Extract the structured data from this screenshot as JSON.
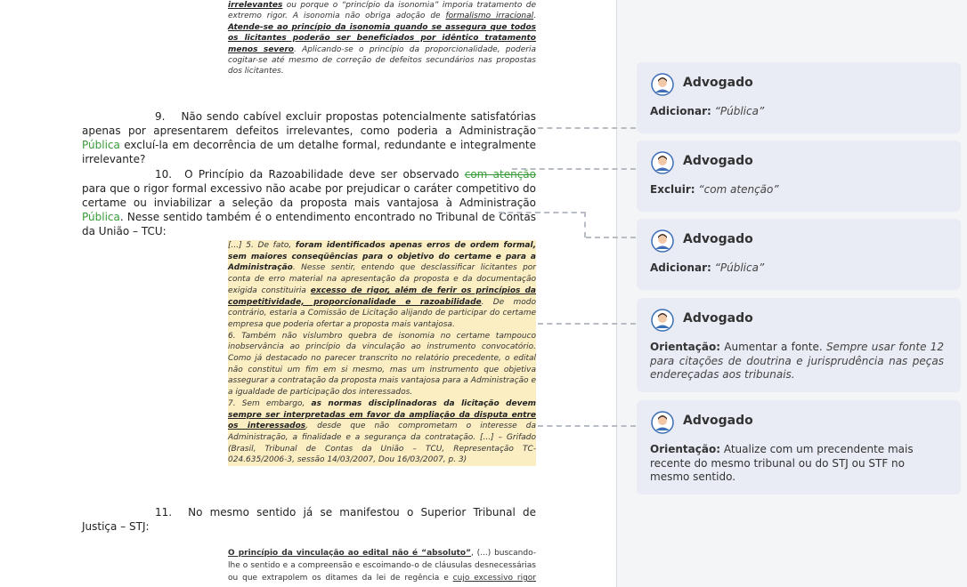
{
  "document": {
    "top_quote": {
      "l1_u": "irrelevantes",
      "l1_rest": " ou porque o “princípio da isonomia” imporia tratamento de",
      "l2": "extremo rigor. A isonomia não obriga adoção de ",
      "l2_u": "formalismo irracional",
      "l2_end": ".",
      "bold_u": "Atende-se ao princípio da isonomia quando se assegura que todos os licitantes poderão ser beneficiados por idêntico tratamento menos severo",
      "rest": ". Aplicando-se o princípio da proporcionalidade, poderia cogitar-se até mesmo de correção de defeitos secundários nas propostas dos licitantes."
    },
    "p9": {
      "number": "9.",
      "text_a": "Não sendo cabível excluir propostas potencialmente satisfatórias apenas por apresentarem defeitos irrelevantes, como poderia a Administração ",
      "inserted": "Pública",
      "text_b": " excluí-la em decorrência de um detalhe formal, redundante e integralmente irrelevante?"
    },
    "p10": {
      "number": "10.",
      "text_a": "O Princípio da Razoabilidade deve ser observado ",
      "deleted": "com atenção",
      "text_b": " para que o rigor formal excessivo não acabe por prejudicar o caráter competitivo do certame ou inviabilizar a seleção da proposta mais vantajosa à Administração ",
      "inserted": "Pública",
      "text_c": ". Nesse sentido também é o entendimento encontrado no Tribunal de Contas da União – TCU:"
    },
    "tcu_quote": {
      "a": "[...] 5. De fato, ",
      "a_b": "foram identificados apenas erros de ordem formal, sem maiores conseqüências para o objetivo do certame e para a Administração",
      "b": ". Nesse sentir, entendo que desclassificar licitantes por conta de erro material na apresentação da proposta e da documentação exigida constituiria ",
      "b_bu": "excesso de rigor, além de ferir os princípios da competitividade, proporcionalidade e razoabilidade",
      "c": ". De modo contrário, estaria a Comissão de Licitação alijando de participar do certame empresa que poderia ofertar a proposta mais vantajosa.",
      "d": "6. Também não vislumbro quebra de isonomia no certame tampouco inobservância ao princípio da vinculação ao instrumento convocatório. Como já destacado no parecer transcrito no relatório precedente, o edital não constitui um fim em si mesmo, mas um instrumento que objetiva assegurar a contratação da proposta mais vantajosa para a Administração e a igualdade de participação dos interessados.",
      "e": "7. Sem embargo, ",
      "e_b": "as normas disciplinadoras da licitação devem ",
      "e_bu": "sempre ser interpretadas em favor da ampliação da disputa entre os interessados",
      "f": ", desde que não comprometam o interesse da Administração, a finalidade e a segurança da contratação. [...] – Grifado (Brasil, Tribunal de Contas da União – TCU, Representação TC-024.635/2006-3, sessão 14/03/2007, Dou 16/03/2007, p. 3)"
    },
    "p11": {
      "number": "11.",
      "text": "No mesmo sentido já se manifestou o Superior Tribunal de Justiça – STJ:"
    },
    "stj_quote": {
      "bu": "O princípio da vinculação ao edital não é “absoluto”",
      "a": ", (...) buscando-lhe o sentido e a compreensão e escoimando-o de cláusulas desnecessárias ou que extrapolem os ditames da lei de regência e ",
      "u": "cujo excessivo rigor possa"
    }
  },
  "comments": [
    {
      "author": "Advogado",
      "label": "Adicionar:",
      "text": "“Pública”",
      "italic": true
    },
    {
      "author": "Advogado",
      "label": "Excluir:",
      "text": "“com atenção”",
      "italic": true
    },
    {
      "author": "Advogado",
      "label": "Adicionar:",
      "text": "“Pública”",
      "italic": true
    },
    {
      "author": "Advogado",
      "label": "Orientação:",
      "text": "Aumentar a fonte.",
      "text2": "Sempre usar fonte 12 para citações de doutrina e jurisprudência nas peças endereçadas aos tribunais."
    },
    {
      "author": "Advogado",
      "label": "Orientação:",
      "text": "Atualize com um precendente mais recente do mesmo tribunal ou do STJ ou STF no mesmo sentido."
    }
  ]
}
